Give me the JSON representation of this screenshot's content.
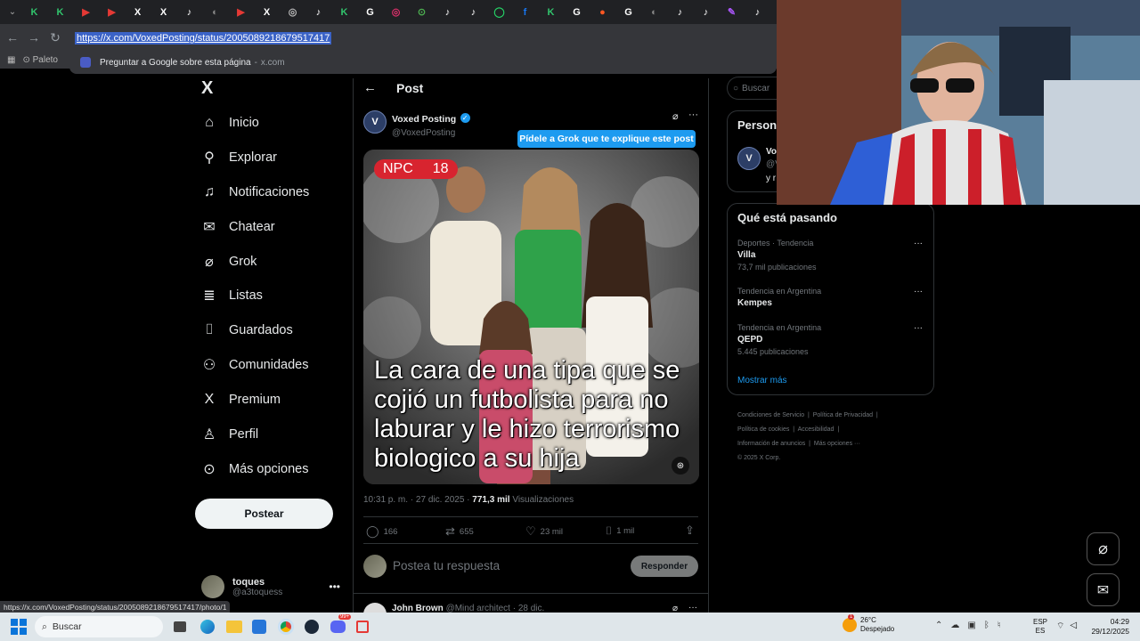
{
  "browser": {
    "url": "https://x.com/VoxedPosting/status/2005089218679517417",
    "suggestion": "Preguntar a Google sobre esta página",
    "suggestion_domain": "x.com",
    "bookmark_label": "Paleto",
    "status_bar_url": "https://x.com/VoxedPosting/status/2005089218679517417/photo/1",
    "tabs": [
      "K",
      "K",
      "▶",
      "▶",
      "X",
      "X",
      "♪",
      "◐",
      "▶",
      "X",
      "◎",
      "♪",
      "K",
      "G",
      "◎",
      "⊙",
      "♪",
      "♪",
      "◯",
      "f",
      "K",
      "G",
      "●",
      "G",
      "◐",
      "♪",
      "♪",
      "✎",
      "♪"
    ]
  },
  "nav": {
    "logo": "X",
    "items": [
      {
        "label": "Inicio",
        "icon": "home-icon"
      },
      {
        "label": "Explorar",
        "icon": "search-icon"
      },
      {
        "label": "Notificaciones",
        "icon": "bell-icon"
      },
      {
        "label": "Chatear",
        "icon": "mail-icon"
      },
      {
        "label": "Grok",
        "icon": "grok-icon"
      },
      {
        "label": "Listas",
        "icon": "list-icon"
      },
      {
        "label": "Guardados",
        "icon": "bookmark-icon"
      },
      {
        "label": "Comunidades",
        "icon": "community-icon"
      },
      {
        "label": "Premium",
        "icon": "x-icon"
      },
      {
        "label": "Perfil",
        "icon": "profile-icon"
      },
      {
        "label": "Más opciones",
        "icon": "more-icon"
      }
    ],
    "post_button": "Postear",
    "account_name": "toques",
    "account_handle": "@a3toquess"
  },
  "post": {
    "header": "Post",
    "author_name": "Voxed Posting",
    "author_handle": "@VoxedPosting",
    "avatar_letter": "V",
    "grok_tooltip": "Pídele a Grok que te explique este post",
    "media_badge_left": "NPC",
    "media_badge_right": "18",
    "media_caption": "La cara de una tipa que se cojió un futbolista para no laburar y le hizo terrorismo biologico a su hija",
    "timestamp": "10:31 p. m. · 27 dic. 2025 ·",
    "views_count": "771,3 mil",
    "views_label": "Visualizaciones",
    "replies": "166",
    "reposts": "655",
    "likes": "23 mil",
    "bookmarks": "1 mil",
    "reply_placeholder": "Postea tu respuesta",
    "reply_button": "Responder",
    "next_reply_name": "John Brown",
    "next_reply_handle": "@Mind architect · 28 dic."
  },
  "right": {
    "search_placeholder": "Buscar",
    "who_to_follow_title": "Person",
    "follow_avatar": "V",
    "follow_name": "Vo",
    "follow_handle": "@V",
    "follow_extra": "y r",
    "trending_title": "Qué está pasando",
    "trends": [
      {
        "context": "Deportes · Tendencia",
        "name": "Villa",
        "count": "73,7 mil publicaciones"
      },
      {
        "context": "Tendencia en Argentina",
        "name": "Kempes",
        "count": ""
      },
      {
        "context": "Tendencia en Argentina",
        "name": "QEPD",
        "count": "5.445 publicaciones"
      }
    ],
    "show_more": "Mostrar más",
    "footer": [
      "Condiciones de Servicio",
      "Política de Privacidad",
      "Política de cookies",
      "Accesibilidad",
      "Información de anuncios",
      "Más opciones ···",
      "© 2025 X Corp."
    ]
  },
  "taskbar": {
    "search_placeholder": "Buscar",
    "weather_temp": "26°C",
    "weather_desc": "Despejado",
    "lang": "ESP",
    "lang_sub": "ES",
    "time": "04:29",
    "date": "29/12/2025",
    "discord_badge": "99+",
    "weather_badge": "1"
  }
}
